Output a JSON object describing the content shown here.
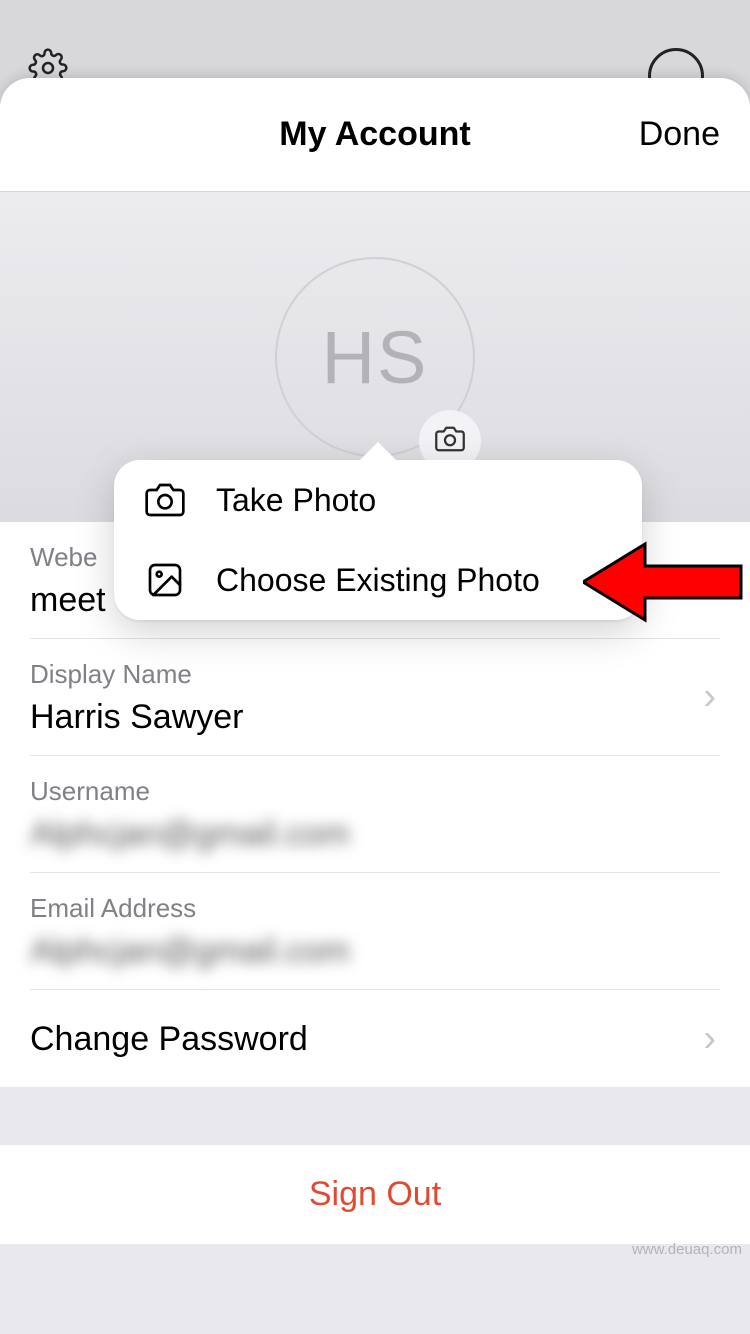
{
  "header": {
    "title": "My Account",
    "done_label": "Done"
  },
  "avatar": {
    "initials": "HS"
  },
  "popover": {
    "items": [
      {
        "label": "Take Photo"
      },
      {
        "label": "Choose Existing Photo"
      }
    ]
  },
  "fields": {
    "webex": {
      "label": "Webe",
      "value": "meet"
    },
    "display_name": {
      "label": "Display Name",
      "value": "Harris Sawyer"
    },
    "username": {
      "label": "Username",
      "value": "Alphcjan@gmail.com"
    },
    "email": {
      "label": "Email Address",
      "value": "Alphcjan@gmail.com"
    },
    "change_password": {
      "label": "Change Password"
    }
  },
  "signout": {
    "label": "Sign Out"
  },
  "watermark": "www.deuaq.com"
}
